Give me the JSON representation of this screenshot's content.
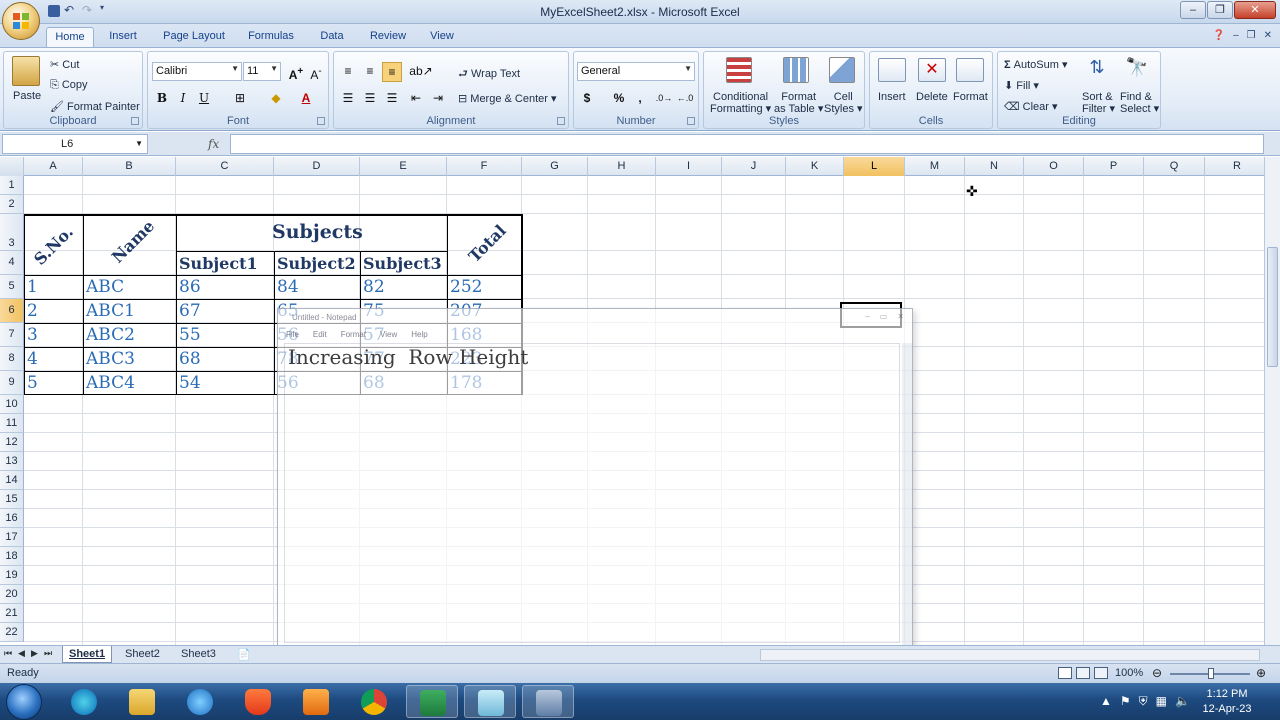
{
  "window": {
    "title": "MyExcelSheet2.xlsx - Microsoft Excel"
  },
  "tabs": [
    "Home",
    "Insert",
    "Page Layout",
    "Formulas",
    "Data",
    "Review",
    "View"
  ],
  "ribbon": {
    "clipboard": {
      "label": "Clipboard",
      "paste": "Paste",
      "cut": "Cut",
      "copy": "Copy",
      "format_painter": "Format Painter"
    },
    "font": {
      "label": "Font",
      "font_name": "Calibri",
      "font_size": "11",
      "bold": "B",
      "italic": "I",
      "underline": "U"
    },
    "alignment": {
      "label": "Alignment",
      "wrap_text": "Wrap Text",
      "merge_center": "Merge & Center"
    },
    "number": {
      "label": "Number",
      "format": "General",
      "currency": "$",
      "percent": "%",
      "comma": ","
    },
    "styles": {
      "label": "Styles",
      "conditional": "Conditional",
      "conditional2": "Formatting",
      "format_table": "Format",
      "format_table2": "as Table",
      "cell_styles": "Cell",
      "cell_styles2": "Styles"
    },
    "cells": {
      "label": "Cells",
      "insert": "Insert",
      "delete": "Delete",
      "format": "Format"
    },
    "editing": {
      "label": "Editing",
      "autosum": "AutoSum",
      "fill": "Fill",
      "clear": "Clear",
      "sort": "Sort &",
      "sort2": "Filter",
      "find": "Find &",
      "find2": "Select"
    }
  },
  "formula_bar": {
    "name_box": "L6",
    "fx": "fx",
    "content": ""
  },
  "columns": [
    "A",
    "B",
    "C",
    "D",
    "E",
    "F",
    "G",
    "H",
    "I",
    "J",
    "K",
    "L",
    "M",
    "N",
    "O",
    "P",
    "Q",
    "R"
  ],
  "selected_column": "L",
  "rows": [
    "1",
    "2",
    "3",
    "4",
    "5",
    "6",
    "7",
    "8",
    "9",
    "10",
    "11",
    "12",
    "13",
    "14",
    "15",
    "16",
    "17",
    "18",
    "19",
    "20",
    "21",
    "22"
  ],
  "selected_row": "6",
  "table": {
    "headers": {
      "sno": "S.No.",
      "name": "Name",
      "subjects": "Subjects",
      "subject1": "Subject1",
      "subject2": "Subject2",
      "subject3": "Subject3",
      "total": "Total"
    },
    "data": [
      [
        "1",
        "ABC",
        "86",
        "84",
        "82",
        "252"
      ],
      [
        "2",
        "ABC1",
        "67",
        "65",
        "75",
        "207"
      ],
      [
        "3",
        "ABC2",
        "55",
        "56",
        "57",
        "168"
      ],
      [
        "4",
        "ABC3",
        "68",
        "78",
        "77",
        "223"
      ],
      [
        "5",
        "ABC4",
        "54",
        "56",
        "68",
        "178"
      ]
    ]
  },
  "notepad": {
    "title": "Untitled - Notepad",
    "menu": [
      "File",
      "Edit",
      "Format",
      "View",
      "Help"
    ],
    "text": "Increasing  Row Height"
  },
  "sheets": [
    "Sheet1",
    "Sheet2",
    "Sheet3"
  ],
  "active_sheet": "Sheet1",
  "status": {
    "ready": "Ready",
    "zoom": "100%"
  },
  "taskbar": {
    "time": "1:12 PM",
    "date": "12-Apr-23"
  },
  "colors": {
    "cell_text": "#2a6bb5",
    "header_text": "#1f3864",
    "selection": "#f1c15f",
    "taskbar": "#1d4a80"
  }
}
